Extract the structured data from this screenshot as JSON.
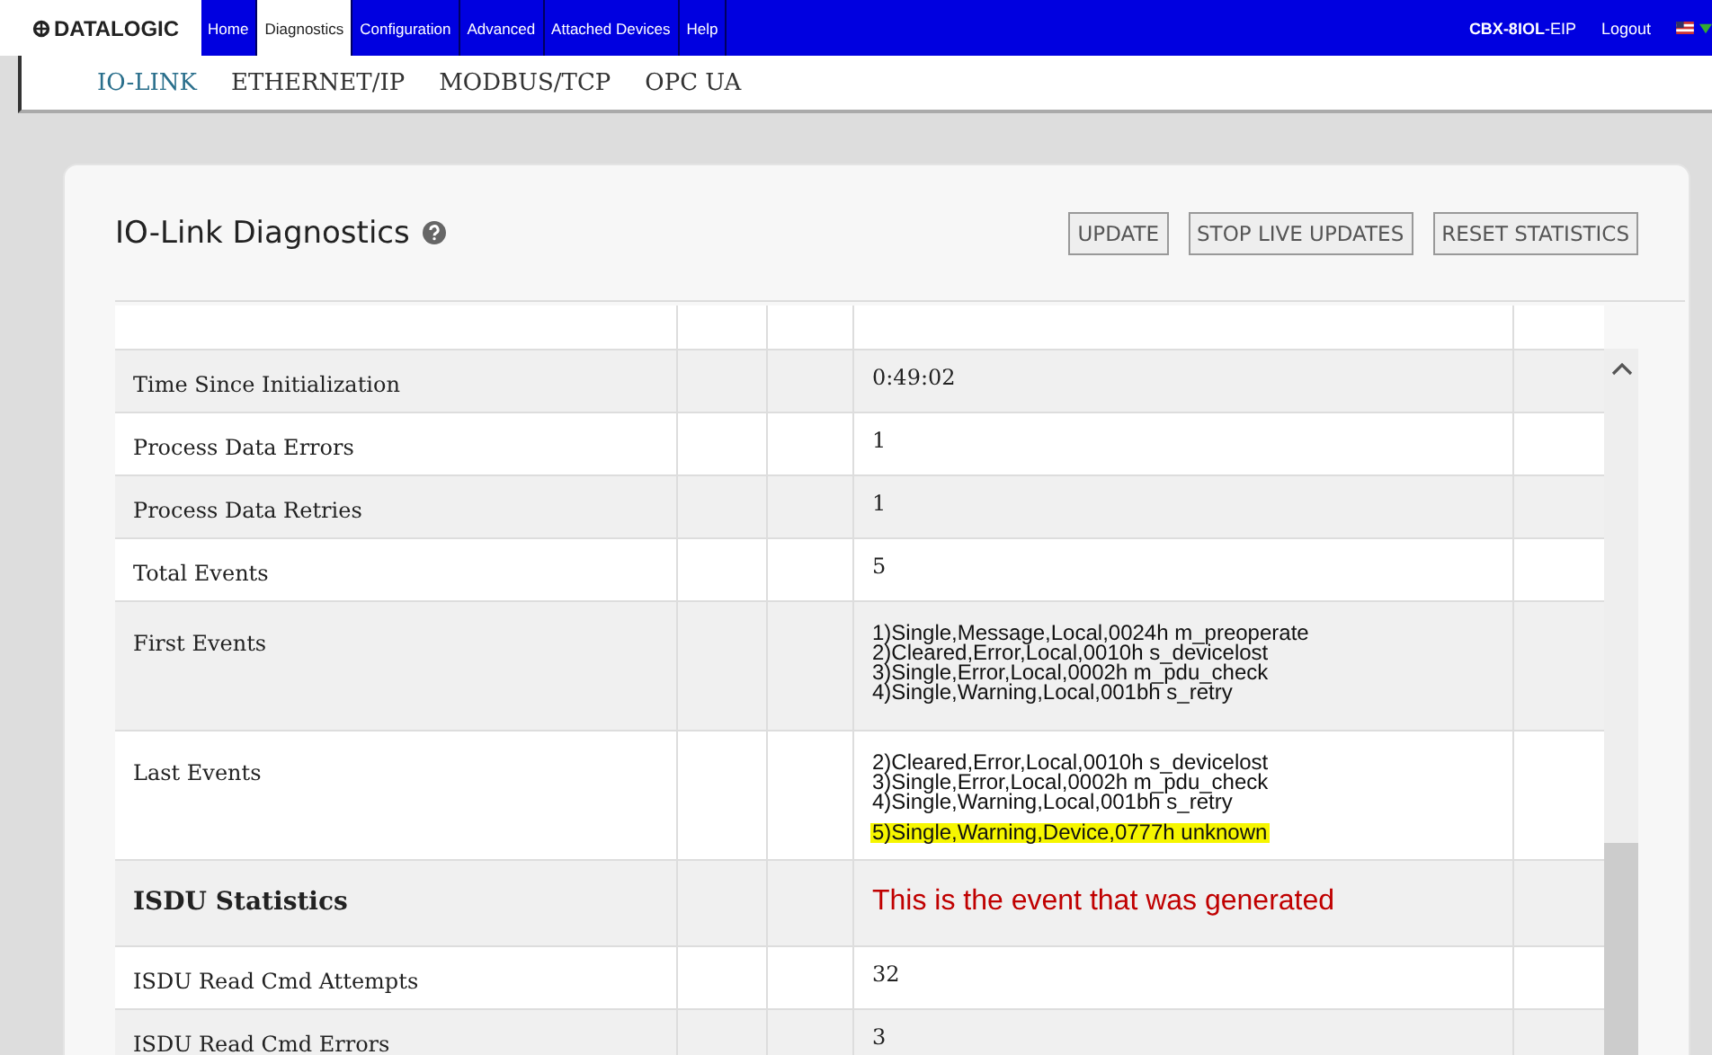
{
  "nav": {
    "logo": "DATALOGIC",
    "items": [
      {
        "label": "Home",
        "selected": false
      },
      {
        "label": "Diagnostics",
        "selected": true
      },
      {
        "label": "Configuration",
        "selected": false
      },
      {
        "label": "Advanced",
        "selected": false
      },
      {
        "label": "Attached Devices",
        "selected": false
      },
      {
        "label": "Help",
        "selected": false
      }
    ],
    "device": "**CBX-8IOL**-EIP",
    "logout": "Logout"
  },
  "subtabs": [
    {
      "label": "IO-LINK",
      "selected": true
    },
    {
      "label": "ETHERNET/IP",
      "selected": false
    },
    {
      "label": "MODBUS/TCP",
      "selected": false
    },
    {
      "label": "OPC UA",
      "selected": false
    }
  ],
  "panel": {
    "title": "IO-Link Diagnostics",
    "buttons": [
      "UPDATE",
      "STOP LIVE UPDATES",
      "RESET STATISTICS"
    ],
    "rows": [
      {
        "kind": "cut"
      },
      {
        "kind": "data",
        "label": "Time Since Initialization",
        "value": "0:49:02"
      },
      {
        "kind": "data",
        "label": "Process Data Errors",
        "value": "1"
      },
      {
        "kind": "data",
        "label": "Process Data Retries",
        "value": "1"
      },
      {
        "kind": "data",
        "label": "Total Events",
        "value": "5"
      },
      {
        "kind": "events",
        "label": "First Events",
        "lines": [
          {
            "text": "1)Single,Message,Local,0024h m_preoperate",
            "highlighted": false
          },
          {
            "text": "2)Cleared,Error,Local,0010h s_devicelost",
            "highlighted": false
          },
          {
            "text": "3)Single,Error,Local,0002h m_pdu_check",
            "highlighted": false
          },
          {
            "text": "4)Single,Warning,Local,001bh s_retry",
            "highlighted": false
          }
        ]
      },
      {
        "kind": "events",
        "label": "Last Events",
        "lines": [
          {
            "text": "2)Cleared,Error,Local,0010h s_devicelost",
            "highlighted": false
          },
          {
            "text": "3)Single,Error,Local,0002h m_pdu_check",
            "highlighted": false
          },
          {
            "text": "4)Single,Warning,Local,001bh s_retry",
            "highlighted": false
          },
          {
            "text": "5)Single,Warning,Device,0777h unknown",
            "highlighted": true
          }
        ]
      },
      {
        "kind": "section",
        "label": "ISDU Statistics",
        "note": "This is the event that was generated"
      },
      {
        "kind": "data",
        "label": "ISDU Read Cmd Attempts",
        "value": "32"
      },
      {
        "kind": "data",
        "label": "ISDU Read Cmd Errors",
        "value": "3"
      }
    ]
  }
}
